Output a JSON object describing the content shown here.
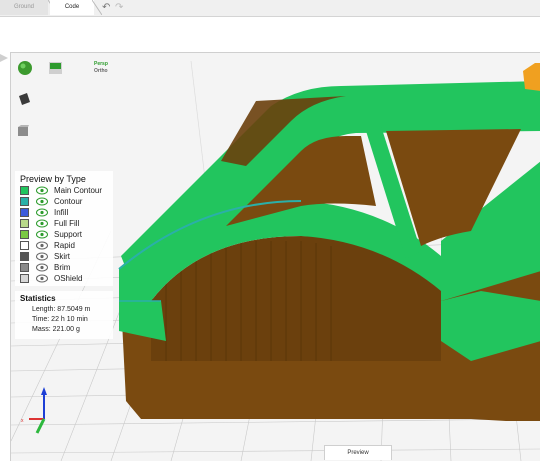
{
  "toolbar": {
    "tabs": [
      {
        "label": "Ground",
        "active": false
      },
      {
        "label": "Code",
        "active": true
      }
    ],
    "undo_icon": "undo-icon",
    "redo_icon": "redo-icon"
  },
  "viewport": {
    "view_modes": {
      "perspective": "Persp",
      "orthographic": "Ortho"
    },
    "icons": [
      "sphere-view-icon",
      "flat-view-icon",
      "object-solid-icon",
      "cube-icon",
      "axes-gizmo-icon",
      "orange-handle-icon"
    ],
    "bottom_tab": "Preview",
    "colors": {
      "main_contour": "#22c55e",
      "contour": "#2ab0a8",
      "infill": "#3b5bdb",
      "full_fill": "#b8d98a",
      "support": "#7ac943",
      "rapid": "#ffffff",
      "skirt": "#555555",
      "brim": "#8a8a8a",
      "oshield": "#d6d6d6",
      "model_brown": "#7a4a10",
      "background": "#f4f4f4"
    }
  },
  "legend": {
    "title": "Preview by Type",
    "items": [
      {
        "label": "Main Contour",
        "color": "#22c55e"
      },
      {
        "label": "Contour",
        "color": "#2ab0a8"
      },
      {
        "label": "Infill",
        "color": "#3b5bdb"
      },
      {
        "label": "Full Fill",
        "color": "#b8d98a"
      },
      {
        "label": "Support",
        "color": "#7ac943"
      },
      {
        "label": "Rapid",
        "color": "#ffffff"
      },
      {
        "label": "Skirt",
        "color": "#555555"
      },
      {
        "label": "Brim",
        "color": "#8a8a8a"
      },
      {
        "label": "OShield",
        "color": "#d6d6d6"
      }
    ]
  },
  "statistics": {
    "title": "Statistics",
    "length": "Length: 87.5049 m",
    "time": "Time: 22 h 10 min",
    "mass": "Mass: 221.00 g"
  }
}
